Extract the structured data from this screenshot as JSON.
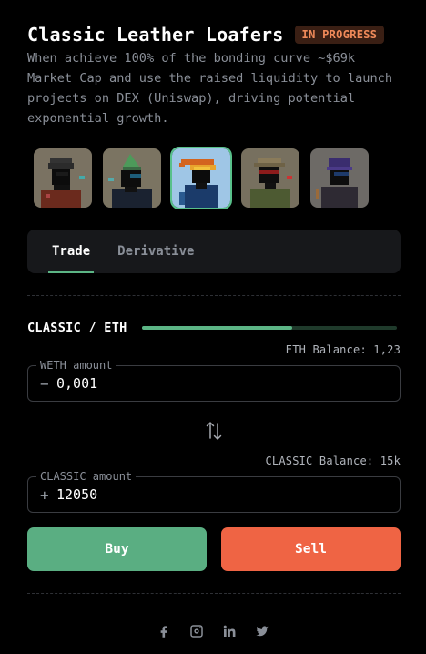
{
  "header": {
    "title": "Classic Leather Loafers",
    "status_badge": "IN PROGRESS",
    "description": "When achieve 100% of the bonding curve ~$69k Market Cap and use the raised liquidity to launch projects on DEX (Uniswap), driving potential exponential growth."
  },
  "nfts": {
    "items": [
      {
        "name": "nft-thumb-1",
        "selected": false
      },
      {
        "name": "nft-thumb-2",
        "selected": false
      },
      {
        "name": "nft-thumb-3",
        "selected": true
      },
      {
        "name": "nft-thumb-4",
        "selected": false
      },
      {
        "name": "nft-thumb-5",
        "selected": false
      }
    ]
  },
  "tabs": [
    {
      "label": "Trade",
      "active": true
    },
    {
      "label": "Derivative",
      "active": false
    }
  ],
  "pair": {
    "label": "CLASSIC / ETH",
    "progress_fraction": 0.59
  },
  "weth": {
    "balance_text": "ETH Balance: 1,23",
    "field_label": "WETH amount",
    "sign": "−",
    "value": "0,001"
  },
  "swap_icon": "swap-arrows-icon",
  "classic": {
    "balance_text": "CLASSIC Balance: 15k",
    "field_label": "CLASSIC amount",
    "sign": "+",
    "value": "12050"
  },
  "actions": {
    "buy_label": "Buy",
    "sell_label": "Sell"
  },
  "socials": [
    "facebook-icon",
    "instagram-icon",
    "linkedin-icon",
    "twitter-icon"
  ],
  "colors": {
    "accent_green": "#5aae82",
    "sell_orange": "#ef6444",
    "badge_text": "#f08a5a",
    "background": "#000000"
  }
}
